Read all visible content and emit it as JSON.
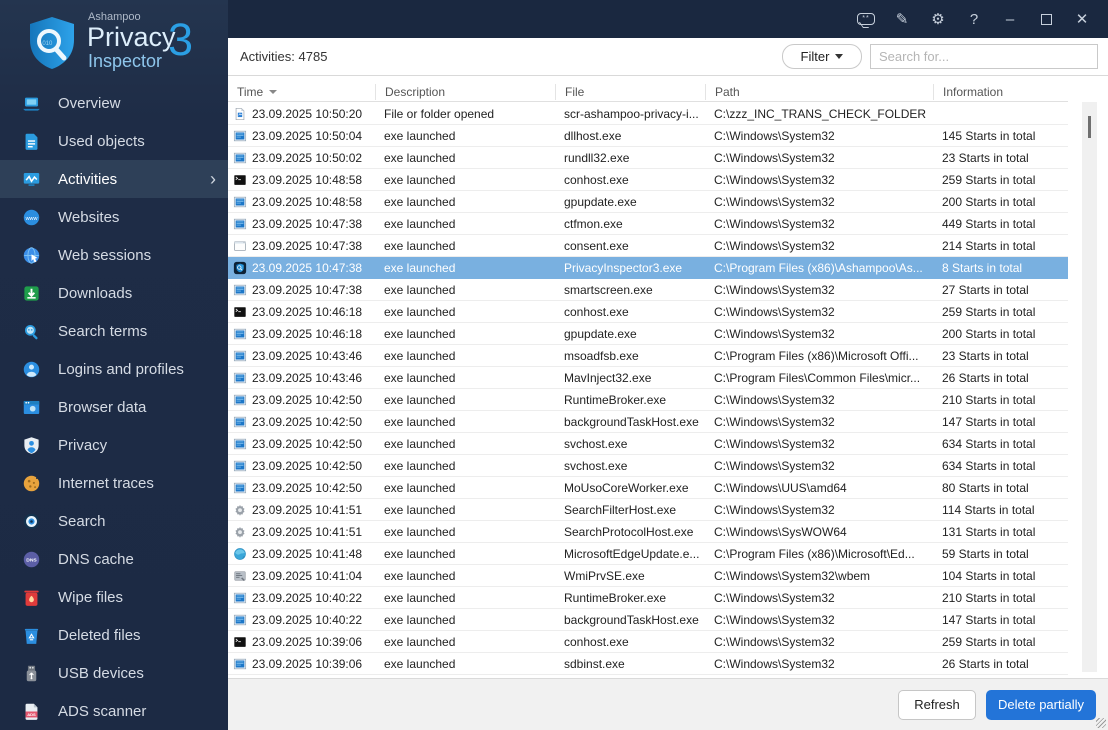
{
  "window": {
    "brand": {
      "company": "Ashampoo",
      "line1": "Privacy",
      "line2": "Inspector",
      "version": "3"
    },
    "titlebar_icons": [
      "feedback-icon",
      "notes-icon",
      "settings-icon",
      "help-icon",
      "minimize-icon",
      "maximize-icon",
      "close-icon"
    ]
  },
  "colors": {
    "accent_blue": "#2b9fe4",
    "selected_row": "#79b0e0",
    "sidebar_bg": "#1e2c46",
    "delete_button": "#2374d8"
  },
  "sidebar": {
    "items": [
      {
        "id": "laptop",
        "label": "Overview",
        "icon": "laptop-icon",
        "selected": false
      },
      {
        "id": "document",
        "label": "Used objects",
        "icon": "document-icon",
        "selected": false
      },
      {
        "id": "activity",
        "label": "Activities",
        "icon": "activity-icon",
        "selected": true
      },
      {
        "id": "www",
        "label": "Websites",
        "icon": "www-icon",
        "selected": false
      },
      {
        "id": "globe-cursor",
        "label": "Web sessions",
        "icon": "globe-cursor-icon",
        "selected": false
      },
      {
        "id": "download",
        "label": "Downloads",
        "icon": "download-icon",
        "selected": false
      },
      {
        "id": "magnifier",
        "label": "Search terms",
        "icon": "magnifier-icon",
        "selected": false
      },
      {
        "id": "person",
        "label": "Logins and profiles",
        "icon": "person-icon",
        "selected": false
      },
      {
        "id": "browser",
        "label": "Browser data",
        "icon": "browser-icon",
        "selected": false
      },
      {
        "id": "privacy-shield",
        "label": "Privacy",
        "icon": "privacy-shield-icon",
        "selected": false
      },
      {
        "id": "cookie",
        "label": "Internet traces",
        "icon": "cookie-icon",
        "selected": false
      },
      {
        "id": "eye",
        "label": "Search",
        "icon": "eye-icon",
        "selected": false
      },
      {
        "id": "dns",
        "label": "DNS cache",
        "icon": "dns-icon",
        "selected": false
      },
      {
        "id": "trash",
        "label": "Wipe files",
        "icon": "trash-icon",
        "selected": false
      },
      {
        "id": "recycle",
        "label": "Deleted files",
        "icon": "recycle-icon",
        "selected": false
      },
      {
        "id": "usb",
        "label": "USB devices",
        "icon": "usb-icon",
        "selected": false
      },
      {
        "id": "ads",
        "label": "ADS scanner",
        "icon": "ads-icon",
        "selected": false
      }
    ]
  },
  "toolbar": {
    "activities_count_label": "Activities: 4785",
    "filter_label": "Filter",
    "search_placeholder": "Search for..."
  },
  "table": {
    "columns": [
      {
        "label": "Time",
        "sorted": true
      },
      {
        "label": "Description",
        "sorted": false
      },
      {
        "label": "File",
        "sorted": false
      },
      {
        "label": "Path",
        "sorted": false
      },
      {
        "label": "Information",
        "sorted": false
      }
    ],
    "rows": [
      {
        "icon": "file-icon",
        "time": "23.09.2025 10:50:20",
        "description": "File or folder opened",
        "file": "scr-ashampoo-privacy-i...",
        "path": "C:\\zzz_INC_TRANS_CHECK_FOLDER",
        "information": "",
        "selected": false
      },
      {
        "icon": "exe-icon",
        "time": "23.09.2025 10:50:04",
        "description": "exe launched",
        "file": "dllhost.exe",
        "path": "C:\\Windows\\System32",
        "information": "145 Starts in total",
        "selected": false
      },
      {
        "icon": "exe-icon",
        "time": "23.09.2025 10:50:02",
        "description": "exe launched",
        "file": "rundll32.exe",
        "path": "C:\\Windows\\System32",
        "information": "23 Starts in total",
        "selected": false
      },
      {
        "icon": "console-icon",
        "time": "23.09.2025 10:48:58",
        "description": "exe launched",
        "file": "conhost.exe",
        "path": "C:\\Windows\\System32",
        "information": "259 Starts in total",
        "selected": false
      },
      {
        "icon": "exe-icon",
        "time": "23.09.2025 10:48:58",
        "description": "exe launched",
        "file": "gpupdate.exe",
        "path": "C:\\Windows\\System32",
        "information": "200 Starts in total",
        "selected": false
      },
      {
        "icon": "exe-icon",
        "time": "23.09.2025 10:47:38",
        "description": "exe launched",
        "file": "ctfmon.exe",
        "path": "C:\\Windows\\System32",
        "information": "449 Starts in total",
        "selected": false
      },
      {
        "icon": "window-icon",
        "time": "23.09.2025 10:47:38",
        "description": "exe launched",
        "file": "consent.exe",
        "path": "C:\\Windows\\System32",
        "information": "214 Starts in total",
        "selected": false
      },
      {
        "icon": "app-shield-icon",
        "time": "23.09.2025 10:47:38",
        "description": "exe launched",
        "file": "PrivacyInspector3.exe",
        "path": "C:\\Program Files (x86)\\Ashampoo\\As...",
        "information": "8 Starts in total",
        "selected": true
      },
      {
        "icon": "exe-icon",
        "time": "23.09.2025 10:47:38",
        "description": "exe launched",
        "file": "smartscreen.exe",
        "path": "C:\\Windows\\System32",
        "information": "27 Starts in total",
        "selected": false
      },
      {
        "icon": "console-icon",
        "time": "23.09.2025 10:46:18",
        "description": "exe launched",
        "file": "conhost.exe",
        "path": "C:\\Windows\\System32",
        "information": "259 Starts in total",
        "selected": false
      },
      {
        "icon": "exe-icon",
        "time": "23.09.2025 10:46:18",
        "description": "exe launched",
        "file": "gpupdate.exe",
        "path": "C:\\Windows\\System32",
        "information": "200 Starts in total",
        "selected": false
      },
      {
        "icon": "exe-icon",
        "time": "23.09.2025 10:43:46",
        "description": "exe launched",
        "file": "msoadfsb.exe",
        "path": "C:\\Program Files (x86)\\Microsoft Offi...",
        "information": "23 Starts in total",
        "selected": false
      },
      {
        "icon": "exe-icon",
        "time": "23.09.2025 10:43:46",
        "description": "exe launched",
        "file": "MavInject32.exe",
        "path": "C:\\Program Files\\Common Files\\micr...",
        "information": "26 Starts in total",
        "selected": false
      },
      {
        "icon": "exe-icon",
        "time": "23.09.2025 10:42:50",
        "description": "exe launched",
        "file": "RuntimeBroker.exe",
        "path": "C:\\Windows\\System32",
        "information": "210 Starts in total",
        "selected": false
      },
      {
        "icon": "exe-icon",
        "time": "23.09.2025 10:42:50",
        "description": "exe launched",
        "file": "backgroundTaskHost.exe",
        "path": "C:\\Windows\\System32",
        "information": "147 Starts in total",
        "selected": false
      },
      {
        "icon": "exe-icon",
        "time": "23.09.2025 10:42:50",
        "description": "exe launched",
        "file": "svchost.exe",
        "path": "C:\\Windows\\System32",
        "information": "634 Starts in total",
        "selected": false
      },
      {
        "icon": "exe-icon",
        "time": "23.09.2025 10:42:50",
        "description": "exe launched",
        "file": "svchost.exe",
        "path": "C:\\Windows\\System32",
        "information": "634 Starts in total",
        "selected": false
      },
      {
        "icon": "exe-icon",
        "time": "23.09.2025 10:42:50",
        "description": "exe launched",
        "file": "MoUsoCoreWorker.exe",
        "path": "C:\\Windows\\UUS\\amd64",
        "information": "80 Starts in total",
        "selected": false
      },
      {
        "icon": "gear-icon",
        "time": "23.09.2025 10:41:51",
        "description": "exe launched",
        "file": "SearchFilterHost.exe",
        "path": "C:\\Windows\\System32",
        "information": "114 Starts in total",
        "selected": false
      },
      {
        "icon": "gear-icon",
        "time": "23.09.2025 10:41:51",
        "description": "exe launched",
        "file": "SearchProtocolHost.exe",
        "path": "C:\\Windows\\SysWOW64",
        "information": "131 Starts in total",
        "selected": false
      },
      {
        "icon": "globe-icon",
        "time": "23.09.2025 10:41:48",
        "description": "exe launched",
        "file": "MicrosoftEdgeUpdate.e...",
        "path": "C:\\Program Files (x86)\\Microsoft\\Ed...",
        "information": "59 Starts in total",
        "selected": false
      },
      {
        "icon": "wmi-icon",
        "time": "23.09.2025 10:41:04",
        "description": "exe launched",
        "file": "WmiPrvSE.exe",
        "path": "C:\\Windows\\System32\\wbem",
        "information": "104 Starts in total",
        "selected": false
      },
      {
        "icon": "exe-icon",
        "time": "23.09.2025 10:40:22",
        "description": "exe launched",
        "file": "RuntimeBroker.exe",
        "path": "C:\\Windows\\System32",
        "information": "210 Starts in total",
        "selected": false
      },
      {
        "icon": "exe-icon",
        "time": "23.09.2025 10:40:22",
        "description": "exe launched",
        "file": "backgroundTaskHost.exe",
        "path": "C:\\Windows\\System32",
        "information": "147 Starts in total",
        "selected": false
      },
      {
        "icon": "console-icon",
        "time": "23.09.2025 10:39:06",
        "description": "exe launched",
        "file": "conhost.exe",
        "path": "C:\\Windows\\System32",
        "information": "259 Starts in total",
        "selected": false
      },
      {
        "icon": "exe-icon",
        "time": "23.09.2025 10:39:06",
        "description": "exe launched",
        "file": "sdbinst.exe",
        "path": "C:\\Windows\\System32",
        "information": "26 Starts in total",
        "selected": false
      }
    ]
  },
  "footer": {
    "refresh_label": "Refresh",
    "delete_label": "Delete partially"
  }
}
